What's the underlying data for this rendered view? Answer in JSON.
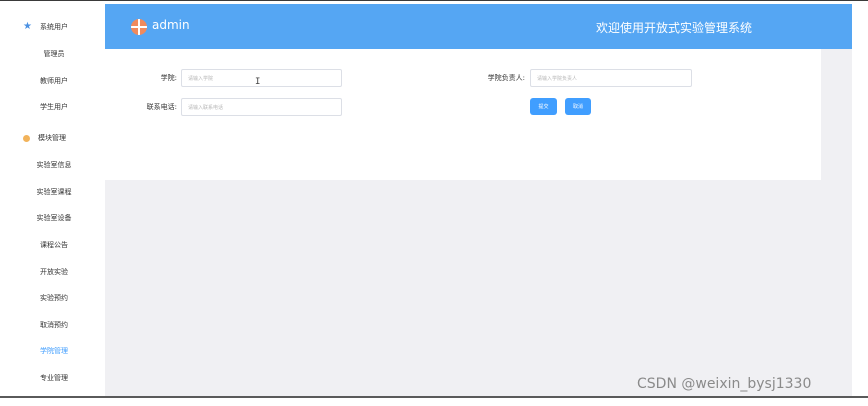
{
  "header": {
    "user_name": "admin",
    "system_title": "欢迎使用开放式实验管理系统"
  },
  "sidebar": {
    "items": [
      {
        "label": "系统用户",
        "type": "group",
        "icon": "star-icon"
      },
      {
        "label": "管理员",
        "type": "item"
      },
      {
        "label": "教师用户",
        "type": "item"
      },
      {
        "label": "学生用户",
        "type": "item"
      },
      {
        "label": "模块管理",
        "type": "group",
        "icon": "grid-icon"
      },
      {
        "label": "实验室信息",
        "type": "item"
      },
      {
        "label": "实验室课程",
        "type": "item"
      },
      {
        "label": "实验室设备",
        "type": "item"
      },
      {
        "label": "课程公告",
        "type": "item"
      },
      {
        "label": "开放实验",
        "type": "item"
      },
      {
        "label": "实验预约",
        "type": "item"
      },
      {
        "label": "取消预约",
        "type": "item"
      },
      {
        "label": "学院管理",
        "type": "item",
        "active": true
      },
      {
        "label": "专业管理",
        "type": "item"
      }
    ]
  },
  "form": {
    "college_label": "学院:",
    "college_placeholder": "请输入学院",
    "leader_label": "学院负责人:",
    "leader_placeholder": "请输入学院负责人",
    "phone_label": "联系电话:",
    "phone_placeholder": "请输入联系电话",
    "submit_label": "提交",
    "cancel_label": "取消"
  },
  "watermark": "CSDN @weixin_bysj1330",
  "colors": {
    "header_bg": "#55a6f3",
    "accent": "#409eff",
    "content_bg": "#f0f0f3"
  }
}
